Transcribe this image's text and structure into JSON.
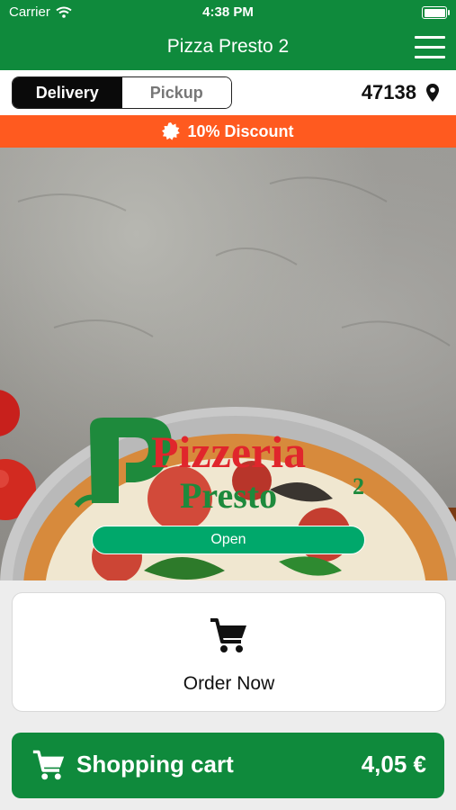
{
  "status_bar": {
    "carrier": "Carrier",
    "time": "4:38 PM"
  },
  "nav": {
    "title": "Pizza Presto 2",
    "menu_icon": "hamburger-menu-icon"
  },
  "mode_selector": {
    "delivery_label": "Delivery",
    "pickup_label": "Pickup",
    "selected": "Delivery"
  },
  "location": {
    "zip": "47138",
    "icon": "location-pin-icon"
  },
  "discount": {
    "text": "10% Discount",
    "icon": "badge-icon"
  },
  "hero": {
    "logo_line1": "Pizzeria",
    "logo_line2": "Presto",
    "logo_superscript": "2",
    "status_label": "Open"
  },
  "order_card": {
    "label": "Order Now",
    "icon": "cart-icon"
  },
  "cart_bar": {
    "label": "Shopping cart",
    "price": "4,05 €",
    "icon": "cart-icon"
  },
  "colors": {
    "brand_green": "#0f8a3c",
    "discount_orange": "#ff5a1f",
    "open_green": "#00a86b",
    "logo_red": "#e0262c"
  }
}
